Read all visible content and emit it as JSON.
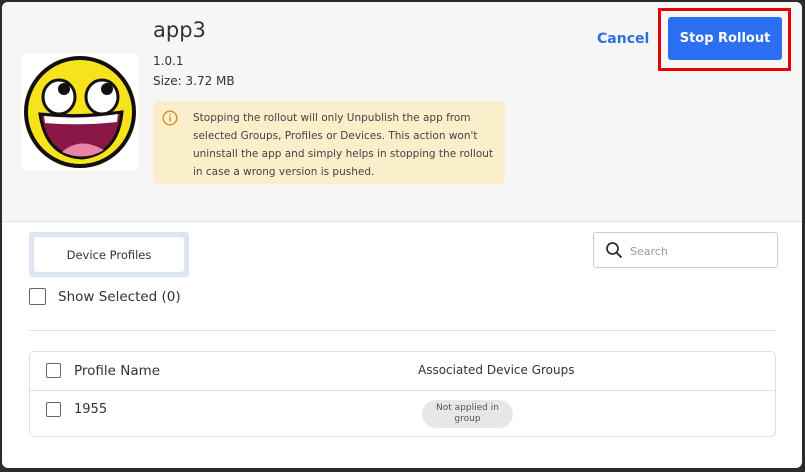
{
  "app": {
    "name": "app3",
    "version": "1.0.1",
    "size": "Size: 3.72 MB",
    "icon": "awesome-smiley-icon"
  },
  "warning": {
    "icon": "info-icon",
    "text": "Stopping the rollout will only Unpublish the app from selected Groups, Profiles or Devices. This action won't uninstall the app and simply helps in stopping the rollout in case a wrong version is pushed."
  },
  "actions": {
    "cancel_label": "Cancel",
    "stop_label": "Stop Rollout"
  },
  "tabs": [
    {
      "label": "Device Profiles",
      "active": true
    }
  ],
  "search": {
    "placeholder": "Search",
    "value": ""
  },
  "show_selected": {
    "label": "Show Selected (0)",
    "checked": false
  },
  "table": {
    "columns": [
      "Profile Name",
      "Associated Device Groups"
    ],
    "rows": [
      {
        "name": "1955",
        "groups": "Not applied in group",
        "checked": false
      }
    ]
  },
  "colors": {
    "accent": "#2c6ff2",
    "highlight": "#e60000",
    "warning_bg": "#fbeecb",
    "warning_icon": "#e08a1e"
  }
}
